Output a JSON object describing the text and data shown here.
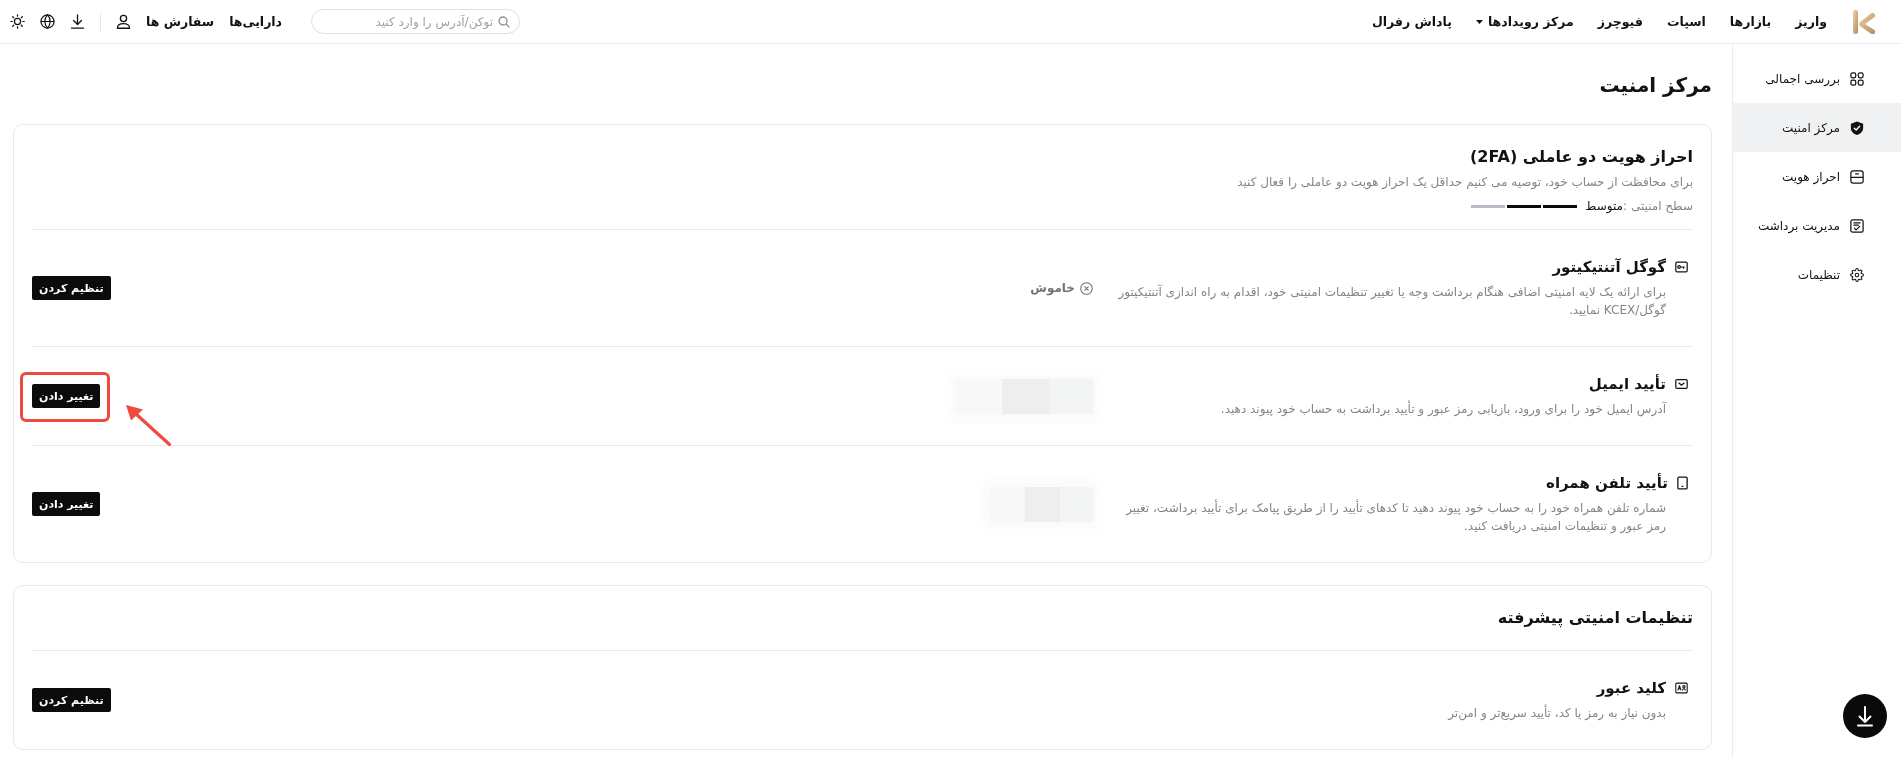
{
  "top_bar": {
    "nav": [
      {
        "label": "واریز",
        "dropdown": false
      },
      {
        "label": "بازارها",
        "dropdown": false
      },
      {
        "label": "اسپات",
        "dropdown": false
      },
      {
        "label": "فیوچرز",
        "dropdown": false
      },
      {
        "label": "مرکز رویدادها",
        "dropdown": true
      },
      {
        "label": "پاداش رفرال",
        "dropdown": false
      }
    ],
    "search": {
      "placeholder": "توکن/آدرس را وارد کنید"
    },
    "links": [
      {
        "label": "دارایی‌ها"
      },
      {
        "label": "سفارش ها"
      }
    ]
  },
  "sidebar": {
    "items": [
      {
        "label": "بررسی اجمالی",
        "kind": "overview",
        "selected": false
      },
      {
        "label": "مرکز امنیت",
        "kind": "security",
        "selected": true
      },
      {
        "label": "احراز هویت",
        "kind": "identity",
        "selected": false
      },
      {
        "label": "مدیریت برداشت",
        "kind": "withdrawal",
        "selected": false
      },
      {
        "label": "تنظیمات",
        "kind": "settings",
        "selected": false
      }
    ]
  },
  "page_title": "مرکز امنیت",
  "sections": [
    {
      "title": "احراز هویت دو عاملی (2FA)",
      "description": "برای محافظت از حساب خود، توصیه می کنیم حداقل یک احراز هویت دو عاملی را فعال کنید",
      "security_level": {
        "label": "سطح امنیتی :",
        "value": "متوسط",
        "level": 0.67
      },
      "rows": [
        {
          "kind": "authenticator",
          "title": "گوگل آتنتیکیتور",
          "description": "برای ارائه یک لایه امنیتی اضافی هنگام برداشت وجه یا تغییر تنظیمات امنیتی خود، اقدام به راه اندازی آتنتیکیتور گوگل/KCEX نمایید.",
          "status": "خاموش",
          "masked_value": false,
          "button": "تنظیم کردن",
          "highlighted": false
        },
        {
          "kind": "email",
          "title": "تأیید ایمیل",
          "description": "آدرس ایمیل خود را برای ورود، بازیابی رمز عبور و تأیید برداشت به حساب خود پیوند دهید.",
          "masked_value": true,
          "button": "تغییر دادن",
          "highlighted": true
        },
        {
          "kind": "phone",
          "title": "تأیید تلفن همراه",
          "description": "شماره تلفن همراه خود را به حساب خود پیوند دهید تا کدهای تأیید را از طریق پیامک برای تأیید برداشت، تغییر رمز عبور و تنظیمات امنیتی دریافت کنید.",
          "masked_value": true,
          "button": "تغییر دادن",
          "highlighted": false
        }
      ]
    },
    {
      "title": "تنظیمات امنیتی پیشرفته",
      "rows": [
        {
          "kind": "passkey",
          "title": "کلید عبور",
          "description": "بدون نیاز به رمز یا کد، تأیید سریع‌تر و امن‌تر",
          "masked_value": false,
          "button": "تنظیم کردن",
          "highlighted": false
        }
      ]
    }
  ]
}
